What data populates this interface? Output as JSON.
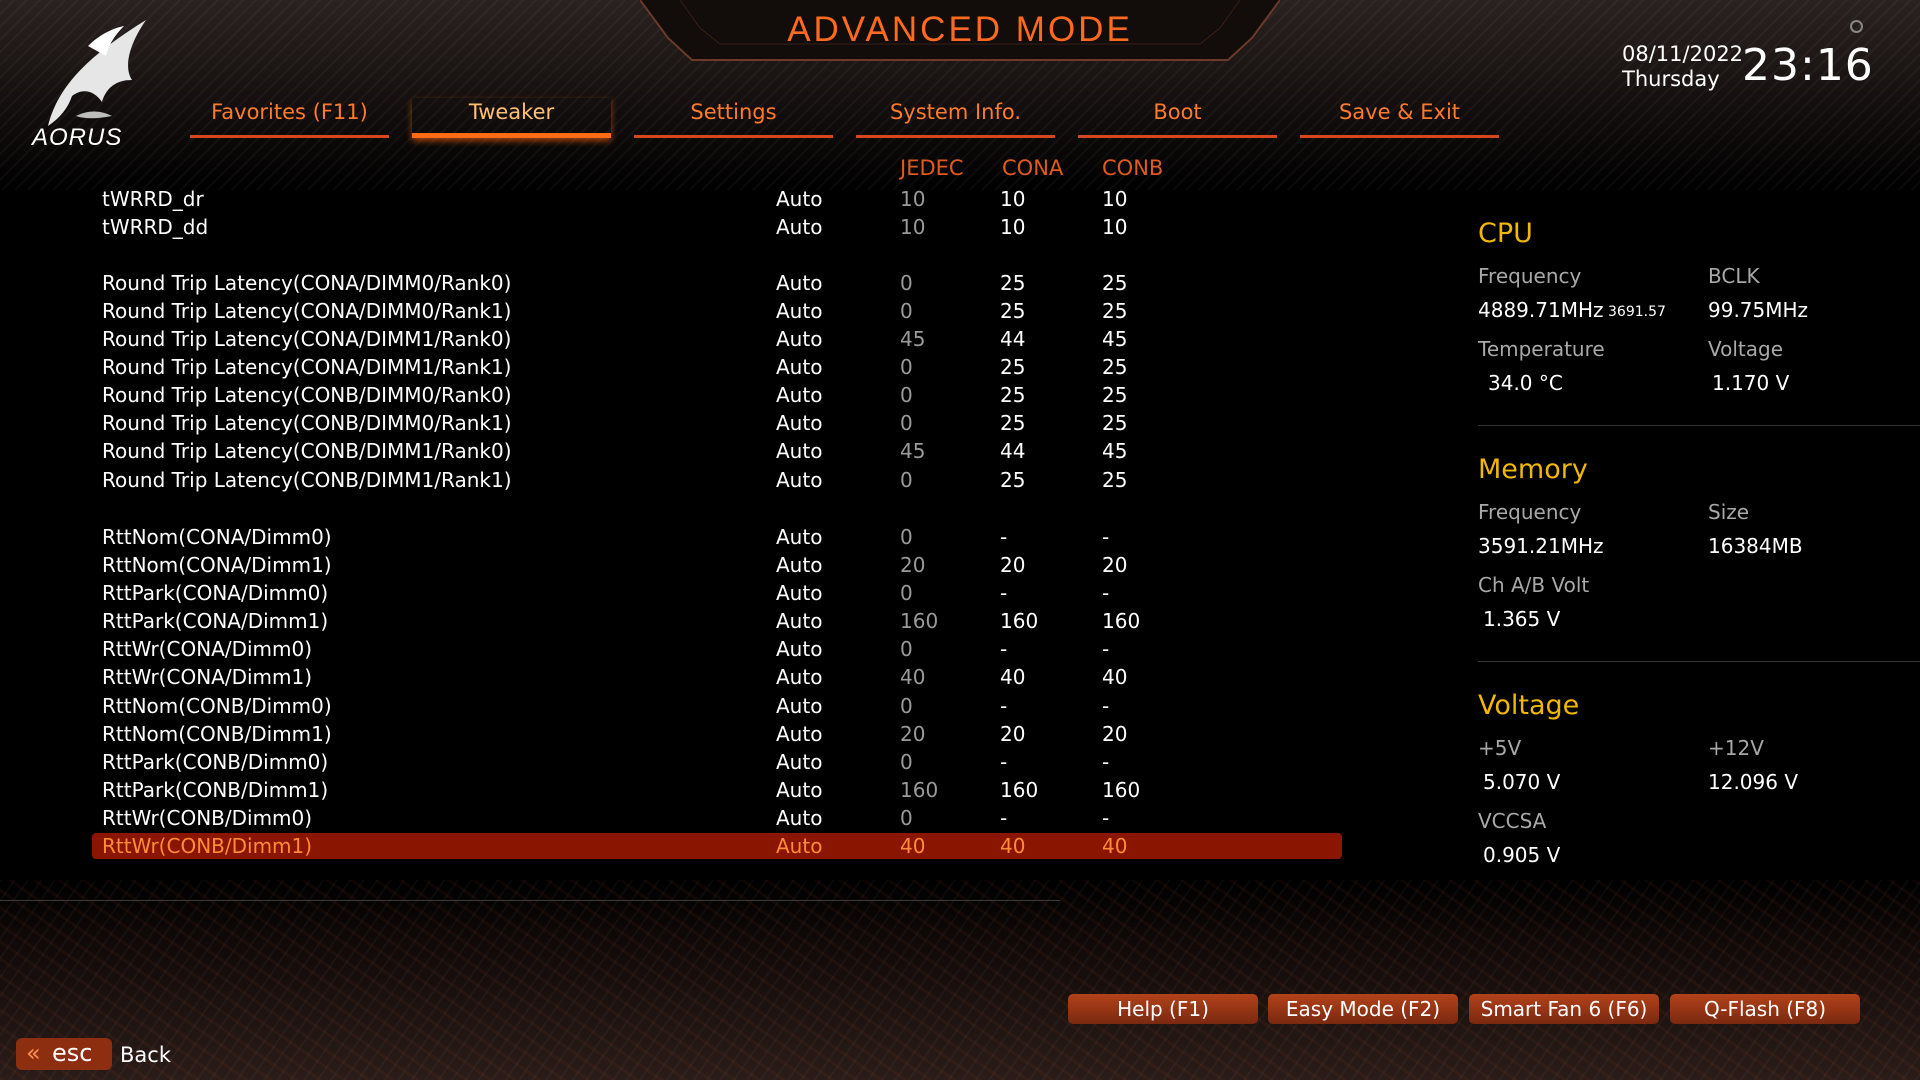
{
  "header": {
    "title": "ADVANCED MODE",
    "brand": "AORUS",
    "date": "08/11/2022",
    "day": "Thursday",
    "time": "23:16"
  },
  "tabs": [
    {
      "label": "Favorites (F11)",
      "active": false
    },
    {
      "label": "Tweaker",
      "active": true
    },
    {
      "label": "Settings",
      "active": false
    },
    {
      "label": "System Info.",
      "active": false
    },
    {
      "label": "Boot",
      "active": false
    },
    {
      "label": "Save & Exit",
      "active": false
    }
  ],
  "columns": {
    "jedec": "JEDEC",
    "cona": "CONA",
    "conb": "CONB"
  },
  "rows": [
    {
      "name": "tWRRD_dr",
      "value": "Auto",
      "jedec": "10",
      "cona": "10",
      "conb": "10"
    },
    {
      "name": "tWRRD_dd",
      "value": "Auto",
      "jedec": "10",
      "cona": "10",
      "conb": "10"
    },
    {
      "name": "Round Trip Latency(CONA/DIMM0/Rank0)",
      "value": "Auto",
      "jedec": "0",
      "cona": "25",
      "conb": "25"
    },
    {
      "name": "Round Trip Latency(CONA/DIMM0/Rank1)",
      "value": "Auto",
      "jedec": "0",
      "cona": "25",
      "conb": "25"
    },
    {
      "name": "Round Trip Latency(CONA/DIMM1/Rank0)",
      "value": "Auto",
      "jedec": "45",
      "cona": "44",
      "conb": "45"
    },
    {
      "name": "Round Trip Latency(CONA/DIMM1/Rank1)",
      "value": "Auto",
      "jedec": "0",
      "cona": "25",
      "conb": "25"
    },
    {
      "name": "Round Trip Latency(CONB/DIMM0/Rank0)",
      "value": "Auto",
      "jedec": "0",
      "cona": "25",
      "conb": "25"
    },
    {
      "name": "Round Trip Latency(CONB/DIMM0/Rank1)",
      "value": "Auto",
      "jedec": "0",
      "cona": "25",
      "conb": "25"
    },
    {
      "name": "Round Trip Latency(CONB/DIMM1/Rank0)",
      "value": "Auto",
      "jedec": "45",
      "cona": "44",
      "conb": "45"
    },
    {
      "name": "Round Trip Latency(CONB/DIMM1/Rank1)",
      "value": "Auto",
      "jedec": "0",
      "cona": "25",
      "conb": "25"
    },
    {
      "name": "RttNom(CONA/Dimm0)",
      "value": "Auto",
      "jedec": "0",
      "cona": "-",
      "conb": "-"
    },
    {
      "name": "RttNom(CONA/Dimm1)",
      "value": "Auto",
      "jedec": "20",
      "cona": "20",
      "conb": "20"
    },
    {
      "name": "RttPark(CONA/Dimm0)",
      "value": "Auto",
      "jedec": "0",
      "cona": "-",
      "conb": "-"
    },
    {
      "name": "RttPark(CONA/Dimm1)",
      "value": "Auto",
      "jedec": "160",
      "cona": "160",
      "conb": "160"
    },
    {
      "name": "RttWr(CONA/Dimm0)",
      "value": "Auto",
      "jedec": "0",
      "cona": "-",
      "conb": "-"
    },
    {
      "name": "RttWr(CONA/Dimm1)",
      "value": "Auto",
      "jedec": "40",
      "cona": "40",
      "conb": "40"
    },
    {
      "name": "RttNom(CONB/Dimm0)",
      "value": "Auto",
      "jedec": "0",
      "cona": "-",
      "conb": "-"
    },
    {
      "name": "RttNom(CONB/Dimm1)",
      "value": "Auto",
      "jedec": "20",
      "cona": "20",
      "conb": "20"
    },
    {
      "name": "RttPark(CONB/Dimm0)",
      "value": "Auto",
      "jedec": "0",
      "cona": "-",
      "conb": "-"
    },
    {
      "name": "RttPark(CONB/Dimm1)",
      "value": "Auto",
      "jedec": "160",
      "cona": "160",
      "conb": "160"
    },
    {
      "name": "RttWr(CONB/Dimm0)",
      "value": "Auto",
      "jedec": "0",
      "cona": "-",
      "conb": "-"
    },
    {
      "name": "RttWr(CONB/Dimm1)",
      "value": "Auto",
      "jedec": "40",
      "cona": "40",
      "conb": "40",
      "selected": true
    }
  ],
  "cpu": {
    "title": "CPU",
    "freq_label": "Frequency",
    "freq_value": "4889.71MHz",
    "freq_extra": "3691.57",
    "bclk_label": "BCLK",
    "bclk_value": "99.75MHz",
    "temp_label": "Temperature",
    "temp_value": "34.0 °C",
    "volt_label": "Voltage",
    "volt_value": "1.170 V"
  },
  "memory": {
    "title": "Memory",
    "freq_label": "Frequency",
    "freq_value": "3591.21MHz",
    "size_label": "Size",
    "size_value": "16384MB",
    "volt_label": "Ch A/B Volt",
    "volt_value": "1.365 V"
  },
  "voltage": {
    "title": "Voltage",
    "v5_label": "+5V",
    "v5_value": "5.070 V",
    "v12_label": "+12V",
    "v12_value": "12.096 V",
    "vccsa_label": "VCCSA",
    "vccsa_value": "0.905 V"
  },
  "footer": {
    "buttons": [
      "Help (F1)",
      "Easy Mode (F2)",
      "Smart Fan 6 (F6)",
      "Q-Flash (F8)"
    ],
    "esc_label": "esc",
    "back_label": "Back"
  },
  "colors": {
    "accent": "#ff6a1f",
    "selected_row": "#8a1500",
    "panel_title": "#f2b800",
    "jedec_text": "#9a9a9a"
  }
}
